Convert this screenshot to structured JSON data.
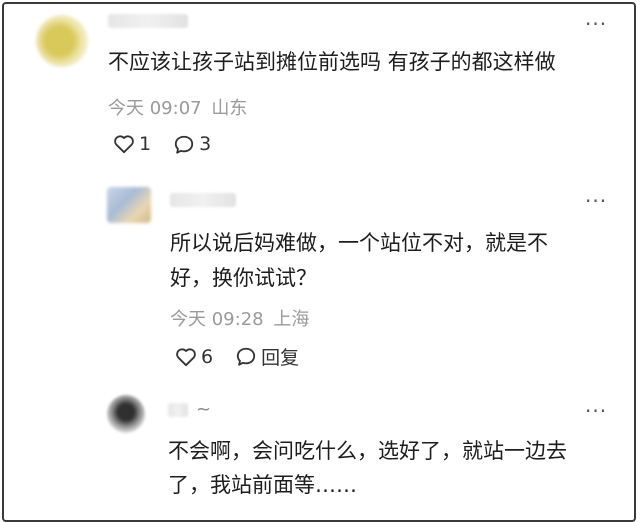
{
  "comments": [
    {
      "text": "不应该让孩子站到摊位前选吗 有孩子的都这样做",
      "time": "今天 09:07",
      "location": "山东",
      "likes": "1",
      "replies": "3",
      "more_glyph": "···"
    },
    {
      "text_lines": [
        "所以说后妈难做，一个站位不对，就是不",
        "好，换你试试？"
      ],
      "time": "今天 09:28",
      "location": "上海",
      "likes": "6",
      "reply_label": "回复",
      "more_glyph": "···"
    },
    {
      "username_suffix": "~",
      "text_lines": [
        "不会啊，会问吃什么，选好了，就站一边去",
        "了，我站前面等……"
      ],
      "more_glyph": "···"
    }
  ],
  "colors": {
    "meta": "#9a9a9a",
    "text": "#1d1d1d",
    "border": "#3a3a3a"
  },
  "icons": {
    "like": "heart-icon",
    "comment": "comment-bubble-icon",
    "more": "more-options-icon"
  }
}
